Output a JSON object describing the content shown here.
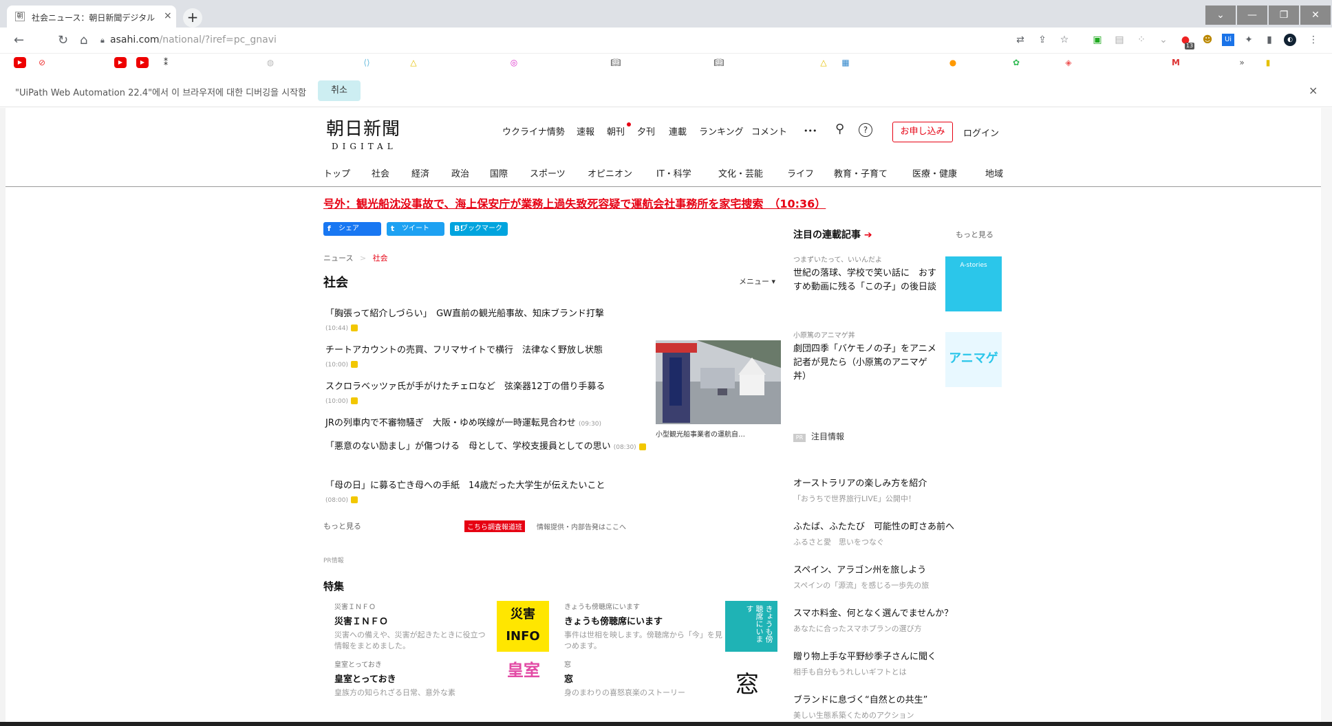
{
  "browser": {
    "tab_title": "社会ニュース：朝日新聞デジタル",
    "tab_favicon": "朝",
    "tab_close": "×",
    "new_tab": "+",
    "url_host": "asahi.com",
    "url_path": "/national/?iref=pc_gnavi",
    "win_buttons": [
      "⌄",
      "—",
      "❐",
      "✕"
    ],
    "ext_badge": "13"
  },
  "infobar": {
    "message": "\"UiPath Web Automation 22.4\"에서 이 브라우저에 대한 디버깅을 시작함",
    "cancel": "취소",
    "close": "×"
  },
  "header": {
    "logo_kanji": "朝日新聞",
    "logo_digital": "DIGITAL",
    "nav": [
      "ウクライナ情勢",
      "速報",
      "朝刊",
      "夕刊",
      "連載",
      "ランキング",
      "コメント",
      "•••"
    ],
    "subscribe": "お申し込み",
    "login": "ログイン"
  },
  "categories": [
    "トップ",
    "社会",
    "経済",
    "政治",
    "国際",
    "スポーツ",
    "オピニオン",
    "IT・科学",
    "文化・芸能",
    "ライフ",
    "教育・子育て",
    "医療・健康",
    "地域"
  ],
  "breaking": "号外：観光船沈没事故で、海上保安庁が業務上過失致死容疑で運航会社事務所を家宅捜索　（10:36）",
  "share": {
    "facebook": "シェア",
    "twitter": "ツイート",
    "hatena": "ブックマーク"
  },
  "breadcrumb": {
    "home": "ニュース",
    "sep": ">",
    "current": "社会"
  },
  "section_title": "社会",
  "menu_label": "メニュー ▾",
  "news": [
    {
      "title": "「胸張って紹介しづらい」　GW直前の観光船事故、知床ブランド打撃",
      "time": "(10:44)"
    },
    {
      "title": "チートアカウントの売買、フリマサイトで横行　法律なく野放し状態",
      "time": "(10:00)"
    },
    {
      "title": "スクロラベッツァ氏が手がけたチェロなど　弦楽器12丁の借り手募る",
      "time": "(10:00)"
    },
    {
      "title": "JRの列車内で不審物騒ぎ　大阪・ゆめ咲線が一時運転見合わせ",
      "time": "(09:30)"
    },
    {
      "title": "「悪意のない励まし」が傷つける　母として、学校支援員としての思い",
      "time": "(08:30)"
    },
    {
      "title": "「母の日」に募る亡き母への手紙　14歳だった大学生が伝えたいこと",
      "time": "(08:00)"
    }
  ],
  "photo_caption": "小型観光船事業者の運航自…",
  "more": "もっと見る",
  "tokudan_tag": "こちら調査報道班",
  "tokudan_text": "情報提供・内部告発はここへ",
  "pr_label": "PR情報",
  "tokushu_title": "特集",
  "features": [
    {
      "kicker": "災害ＩＮＦＯ",
      "title": "災害ＩＮＦＯ",
      "desc": "災害への備えや、災害が起きたときに役立つ情報をまとめました。",
      "thumb": "災害INFO"
    },
    {
      "kicker": "きょうも傍聴席にいます",
      "title": "きょうも傍聴席にいます",
      "desc": "事件は世相を映します。傍聴席から「今」を見つめます。",
      "thumb": "きょうも傍聴席にいます"
    },
    {
      "kicker": "皇室とっておき",
      "title": "皇室とっておき",
      "desc": "皇族方の知られざる日常、意外な素",
      "thumb": "皇室"
    },
    {
      "kicker": "窓",
      "title": "窓",
      "desc": "身のまわりの喜怒哀楽のストーリー",
      "thumb": "窓"
    }
  ],
  "right": {
    "title": "注目の連載記事",
    "arrow": "➔",
    "more": "もっと見る",
    "items": [
      {
        "kicker": "つまずいたって、いいんだよ",
        "title": "世紀の落球、学校で笑い話に　おすすめ動画に残る「この子」の後日談",
        "thumb": "A-stories"
      },
      {
        "kicker": "小原篤のアニマゲ丼",
        "title": "劇団四季「バケモノの子」をアニメ記者が見たら（小原篤のアニマゲ丼）",
        "thumb": "アニマゲ"
      }
    ],
    "pr_tag": "PR",
    "pr_title": "注目情報",
    "pr_items": [
      {
        "title": "オーストラリアの楽しみ方を紹介",
        "sub": "「おうちで世界旅行LIVE」公開中！"
      },
      {
        "title": "ふたば、ふたたび　可能性の町さあ前へ",
        "sub": "ふるさと愛　思いをつなぐ"
      },
      {
        "title": "スペイン、アラゴン州を旅しよう",
        "sub": "スペインの「源流」を感じる一歩先の旅"
      },
      {
        "title": "スマホ料金、何となく選んでませんか？",
        "sub": "あなたに合ったスマホプランの選び方"
      },
      {
        "title": "贈り物上手な平野紗季子さんに聞く",
        "sub": "相手も自分もうれしいギフトとは"
      },
      {
        "title": "ブランドに息づく“自然との共生”",
        "sub": "美しい生態系築くためのアクション"
      }
    ]
  }
}
